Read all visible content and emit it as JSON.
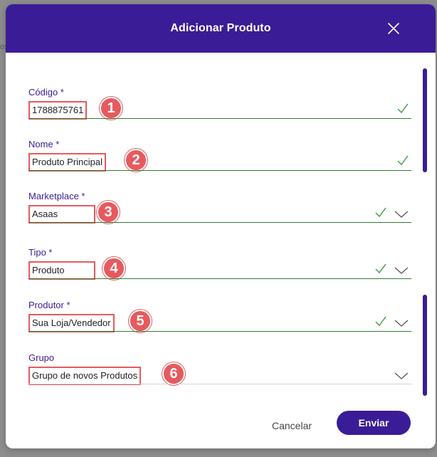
{
  "background": {
    "hint_text": "os"
  },
  "modal": {
    "title": "Adicionar Produto",
    "close_icon": "close-icon",
    "accent_color": "#3a1c96",
    "annotation_color": "#e65a5e"
  },
  "fields": {
    "codigo": {
      "label": "Código *",
      "value": "1788875761",
      "badge": "1",
      "valid": true,
      "dropdown": false
    },
    "nome": {
      "label": "Nome *",
      "value": "Produto Principal",
      "badge": "2",
      "valid": true,
      "dropdown": false
    },
    "marketplace": {
      "label": "Marketplace *",
      "value": "Asaas",
      "badge": "3",
      "valid": true,
      "dropdown": true
    },
    "tipo": {
      "label": "Tipo *",
      "value": "Produto",
      "badge": "4",
      "valid": true,
      "dropdown": true
    },
    "produtor": {
      "label": "Produtor *",
      "value": "Sua Loja/Vendedor",
      "badge": "5",
      "valid": true,
      "dropdown": true
    },
    "grupo": {
      "label": "Grupo",
      "value": "Grupo de novos Produtos",
      "badge": "6",
      "valid": false,
      "dropdown": true
    }
  },
  "footer": {
    "cancel_label": "Cancelar",
    "submit_label": "Enviar"
  }
}
